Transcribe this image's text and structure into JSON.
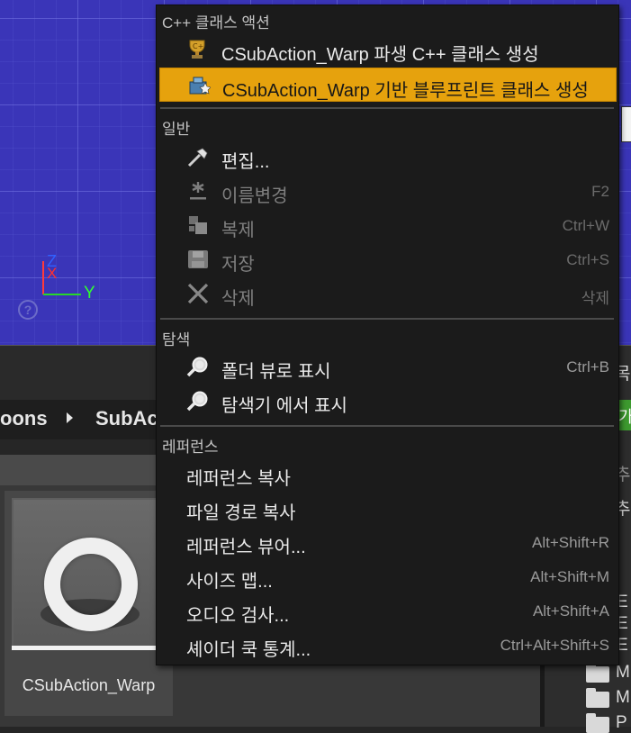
{
  "viewport": {
    "axis_z": "Z",
    "axis_x": "X",
    "axis_y": "Y",
    "help_glyph": "?"
  },
  "content_browser": {
    "breadcrumb_prev": "oons",
    "breadcrumb_current": "SubAc",
    "asset_name": "CSubAction_Warp",
    "right_panel": {
      "green_button_text": "가",
      "text_rows": [
        "목록",
        "추가",
        "E",
        "E",
        "E",
        "M",
        "M",
        "P"
      ]
    }
  },
  "menu": {
    "sections": {
      "cpp": "C++ 클래스 액션",
      "general": "일반",
      "explore": "탐색",
      "references": "레퍼런스"
    },
    "items": {
      "derive_cpp": {
        "label": "CSubAction_Warp 파생 C++ 클래스 생성",
        "icon": "cpp-class-icon"
      },
      "create_bp": {
        "label": "CSubAction_Warp 기반 블루프린트 클래스 생성",
        "icon": "blueprint-class-icon"
      },
      "edit": {
        "label": "편집...",
        "icon": "edit-icon"
      },
      "rename": {
        "label": "이름변경",
        "shortcut": "F2",
        "icon": "rename-icon"
      },
      "duplicate": {
        "label": "복제",
        "shortcut": "Ctrl+W",
        "icon": "duplicate-icon"
      },
      "save": {
        "label": "저장",
        "shortcut": "Ctrl+S",
        "icon": "save-icon"
      },
      "delete": {
        "label": "삭제",
        "shortcut": "삭제",
        "icon": "delete-icon"
      },
      "show_in_folder_view": {
        "label": "폴더 뷰로 표시",
        "shortcut": "Ctrl+B",
        "icon": "search-icon"
      },
      "show_in_explorer": {
        "label": "탐색기 에서 표시",
        "icon": "search-icon"
      },
      "copy_reference": {
        "label": "레퍼런스 복사"
      },
      "copy_file_path": {
        "label": "파일 경로 복사"
      },
      "reference_viewer": {
        "label": "레퍼런스 뷰어...",
        "shortcut": "Alt+Shift+R"
      },
      "size_map": {
        "label": "사이즈 맵...",
        "shortcut": "Alt+Shift+M"
      },
      "audit_asset": {
        "label": "오디오 검사...",
        "shortcut": "Alt+Shift+A"
      },
      "shader_cook_stats": {
        "label": "셰이더 쿡 통계...",
        "shortcut": "Ctrl+Alt+Shift+S"
      }
    },
    "highlighted": "create_bp"
  },
  "colors": {
    "highlight": "#e6a20d",
    "menu_bg": "#1b1b1b",
    "viewport_bg": "#3a35b8"
  }
}
